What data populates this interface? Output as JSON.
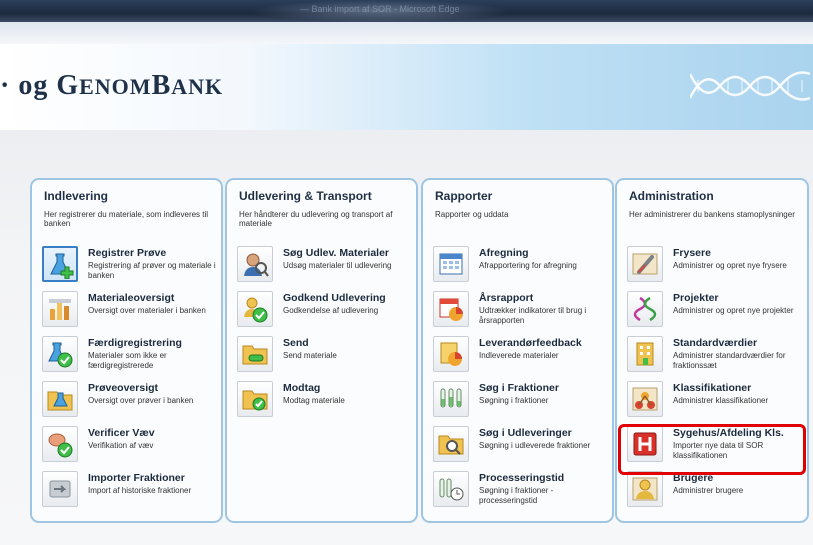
{
  "window": {
    "title_blurred": "— Bank import af SOR - Microsoft Edge"
  },
  "banner": {
    "title_prefix": "· og ",
    "title_g": "G",
    "title_enom": "enom",
    "title_b": "B",
    "title_ank": "ank"
  },
  "panels": [
    {
      "title": "Indlevering",
      "desc": "Her registrerer du materiale, som indleveres til banken",
      "items": [
        {
          "title": "Registrer Prøve",
          "sub": "Registrering af prøver og materiale i banken",
          "icon": "flask-add-icon"
        },
        {
          "title": "Materialeoversigt",
          "sub": "Oversigt over materialer i banken",
          "icon": "chart-bars-icon"
        },
        {
          "title": "Færdigregistrering",
          "sub": "Materialer som ikke er færdigregistrerede",
          "icon": "flask-check-icon"
        },
        {
          "title": "Prøveoversigt",
          "sub": "Oversigt over prøver i banken",
          "icon": "folder-flask-icon"
        },
        {
          "title": "Verificer Væv",
          "sub": "Verifikation af væv",
          "icon": "tissue-check-icon"
        },
        {
          "title": "Importer Fraktioner",
          "sub": "Import af historiske fraktioner",
          "icon": "import-icon"
        }
      ]
    },
    {
      "title": "Udlevering & Transport",
      "desc": "Her håndterer du udlevering og transport af materiale",
      "items": [
        {
          "title": "Søg Udlev. Materialer",
          "sub": "Udsøg materialer til udlevering",
          "icon": "person-search-icon"
        },
        {
          "title": "Godkend Udlevering",
          "sub": "Godkendelse af udlevering",
          "icon": "person-check-icon"
        },
        {
          "title": "Send",
          "sub": "Send materiale",
          "icon": "folder-send-icon"
        },
        {
          "title": "Modtag",
          "sub": "Modtag materiale",
          "icon": "folder-check-icon"
        }
      ]
    },
    {
      "title": "Rapporter",
      "desc": "Rapporter og uddata",
      "items": [
        {
          "title": "Afregning",
          "sub": "Afrapportering for afregning",
          "icon": "calendar-grid-icon"
        },
        {
          "title": "Årsrapport",
          "sub": "Udtrækker indikatorer til brug i årsrapporten",
          "icon": "calendar-pie-icon"
        },
        {
          "title": "Leverandørfeedback",
          "sub": "Indleverede materialer",
          "icon": "doc-pie-icon"
        },
        {
          "title": "Søg i Fraktioner",
          "sub": "Søgning i fraktioner",
          "icon": "test-tubes-icon"
        },
        {
          "title": "Søg i Udleveringer",
          "sub": "Søgning i udleverede fraktioner",
          "icon": "folder-search-icon"
        },
        {
          "title": "Processeringstid",
          "sub": "Søgning i fraktioner - processeringstid",
          "icon": "tubes-clock-icon"
        }
      ]
    },
    {
      "title": "Administration",
      "desc": "Her administrerer du bankens stamoplysninger",
      "items": [
        {
          "title": "Frysere",
          "sub": "Administrer og opret nye frysere",
          "icon": "thermometer-icon"
        },
        {
          "title": "Projekter",
          "sub": "Administrer og opret nye projekter",
          "icon": "dna-icon"
        },
        {
          "title": "Standardværdier",
          "sub": "Administrer standardværdier for fraktionssæt",
          "icon": "building-icon"
        },
        {
          "title": "Klassifikationer",
          "sub": "Administrer klassifikationer",
          "icon": "molecule-icon"
        },
        {
          "title": "Sygehus/Afdeling Kls.",
          "sub": "Importer nye data til SOR klassifikationen",
          "icon": "hospital-icon"
        },
        {
          "title": "Brugere",
          "sub": "Administrer brugere",
          "icon": "user-icon"
        }
      ]
    }
  ]
}
